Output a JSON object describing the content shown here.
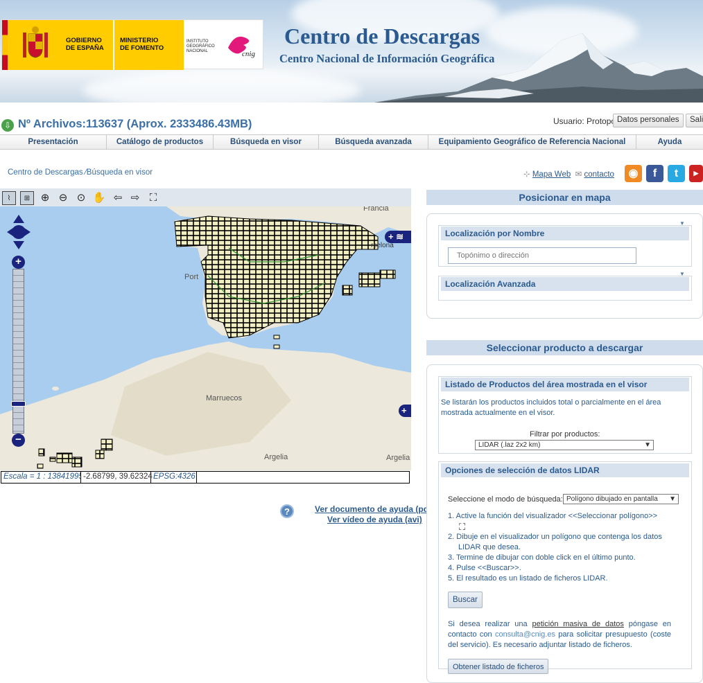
{
  "banner": {
    "gov_line1": "GOBIERNO",
    "gov_line2": "DE ESPAÑA",
    "min_line1": "MINISTERIO",
    "min_line2": "DE FOMENTO",
    "ign_line1": "INSTITUTO",
    "ign_line2": "GEOGRÁFICO",
    "ign_line3": "NACIONAL",
    "cnig_label": "cnig",
    "title": "Centro de Descargas",
    "subtitle": "Centro Nacional de Información Geográfica"
  },
  "status": {
    "archivos": "Nº Archivos:113637 (Aprox. 2333486.43MB)",
    "usuario": "Usuario: Protopo",
    "datos_btn": "Datos personales",
    "salir_btn": "Salir"
  },
  "nav": {
    "items": [
      "Presentación",
      "Catálogo de productos",
      "Búsqueda en visor",
      "Búsqueda avanzada",
      "Equipamiento Geográfico de Referencia Nacional",
      "Ayuda"
    ]
  },
  "breadcrumb": {
    "home": "Centro de Descargas",
    "sep": "⁄",
    "current": "Búsqueda en visor"
  },
  "toplinks": {
    "mapa_web": "Mapa Web",
    "contacto": "contacto"
  },
  "map": {
    "labels": {
      "francia": "Francia",
      "portugal": "Port",
      "barcelona": "rcelona",
      "marruecos": "Marruecos",
      "argelia1": "Argelia",
      "argelia2": "Argelia"
    },
    "scale": "Escala = 1 : 13841995",
    "coords": "-2.68799, 39.62324",
    "epsg": "EPSG:4326"
  },
  "help": {
    "doc": "Ver documento de ayuda (pdf)",
    "video": "Ver vídeo de ayuda (avi)"
  },
  "posicionar": {
    "title": "Posicionar en mapa",
    "loc_nombre": "Localización por Nombre",
    "placeholder": "Topónimo o dirección",
    "loc_avanzada": "Localización Avanzada"
  },
  "producto": {
    "title": "Seleccionar producto a descargar",
    "listado_head": "Listado de Productos del área mostrada en el visor",
    "listado_text1": "Se listarán los productos incluidos total o parcialmente en el área",
    "listado_text2": "mostrada actualmente en el visor.",
    "filtrar": "Filtrar por productos:",
    "filtro_value": "LIDAR (.laz 2x2 km)",
    "opciones_head": "Opciones de selección de datos LIDAR",
    "modo_label": "Seleccione el modo de búsqueda:",
    "modo_value": "Polígono dibujado en pantalla",
    "steps": [
      "1.  Active la función del visualizador <<Seleccionar polígono>>",
      "2.  Dibuje en el visualizador un polígono que contenga los datos",
      "     LIDAR que desea.",
      "3.  Termine de dibujar con doble click en el último punto.",
      "4.  Pulse <<Buscar>>.",
      "5.  El resultado es un listado de ficheros LIDAR."
    ],
    "buscar_btn": "Buscar",
    "masiva_1": "Si desea realizar una",
    "masiva_link": "petición masiva de datos",
    "masiva_2": "póngase en",
    "masiva_3": "contacto con",
    "email": "consulta@cnig.es",
    "masiva_4": "para solicitar presupuesto (coste",
    "masiva_5": "del servicio). Es necesario adjuntar listado de ficheros.",
    "obtener_btn": "Obtener listado de ficheros"
  }
}
